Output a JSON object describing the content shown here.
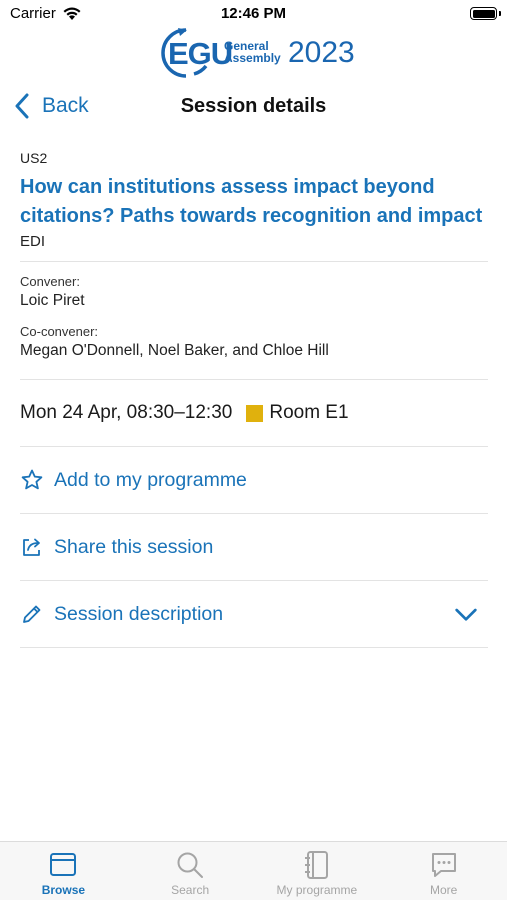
{
  "status_bar": {
    "carrier": "Carrier",
    "time": "12:46 PM"
  },
  "logo": {
    "mark": "EGU",
    "line1": "General",
    "line2": "Assembly",
    "year": "2023"
  },
  "nav": {
    "back_label": "Back",
    "title": "Session details"
  },
  "session": {
    "code": "US2",
    "title": "How can institutions assess impact beyond citations? Paths towards recognition and impact",
    "division": "EDI",
    "convener_label": "Convener:",
    "convener": "Loic Piret",
    "coconvener_label": "Co-convener:",
    "coconveners": "Megan O'Donnell, Noel Baker, and Chloe Hill",
    "datetime": "Mon 24 Apr, 08:30–12:30",
    "room": "Room E1",
    "room_color": "#e0b10d"
  },
  "actions": {
    "add": "Add to my programme",
    "share": "Share this session",
    "description": "Session description"
  },
  "tabs": [
    {
      "label": "Browse",
      "icon": "browse-icon"
    },
    {
      "label": "Search",
      "icon": "search-icon"
    },
    {
      "label": "My programme",
      "icon": "notebook-icon"
    },
    {
      "label": "More",
      "icon": "chat-more-icon"
    }
  ],
  "colors": {
    "accent": "#1a73b8",
    "brand": "#1a66b0",
    "inactive_tab": "#a5a5a5"
  }
}
